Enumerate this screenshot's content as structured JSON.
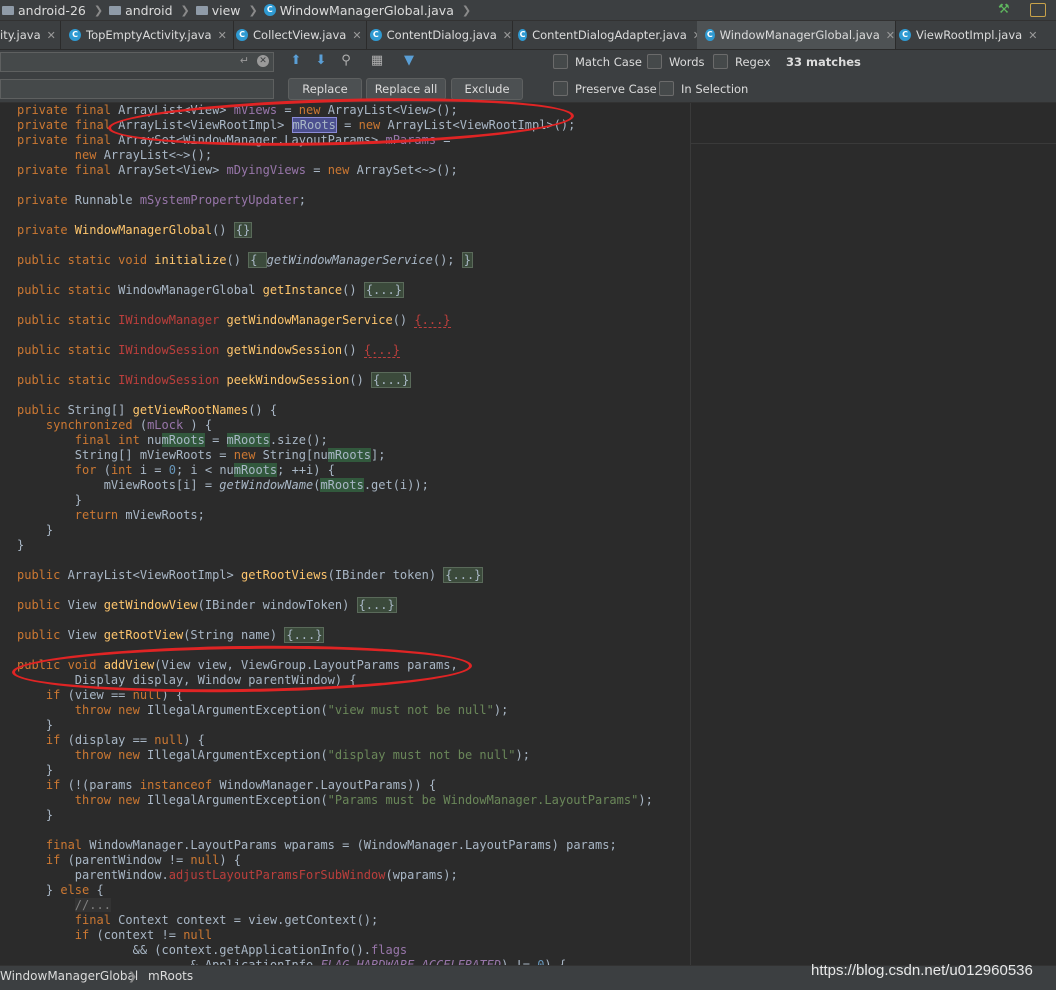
{
  "navbar": {
    "crumbs": [
      "android-26",
      "android",
      "view",
      "WindowManagerGlobal.java"
    ]
  },
  "tabs": [
    {
      "label": "ity.java",
      "active": false
    },
    {
      "label": "TopEmptyActivity.java",
      "active": false
    },
    {
      "label": "CollectView.java",
      "active": false
    },
    {
      "label": "ContentDialog.java",
      "active": false
    },
    {
      "label": "ContentDialogAdapter.java",
      "active": false
    },
    {
      "label": "WindowManagerGlobal.java",
      "active": true
    },
    {
      "label": "ViewRootImpl.java",
      "active": false
    }
  ],
  "find": {
    "search_value": "",
    "replace_value": "",
    "replace_label": "Replace",
    "replace_all_label": "Replace all",
    "exclude_label": "Exclude",
    "match_case_label": "Match Case",
    "words_label": "Words",
    "regex_label": "Regex",
    "matches_label": "33 matches",
    "preserve_case_label": "Preserve Case",
    "in_selection_label": "In Selection"
  },
  "editor": {
    "lines": [
      [
        [
          "kw",
          "private final "
        ],
        [
          "",
          "ArrayList<View> "
        ],
        [
          "fld",
          "mViews"
        ],
        [
          "",
          " = "
        ],
        [
          "kw",
          "new "
        ],
        [
          "",
          "ArrayList<View>();"
        ]
      ],
      [
        [
          "kw",
          "private final "
        ],
        [
          "",
          "ArrayList<ViewRootImpl> "
        ],
        [
          "sel",
          "mRoots"
        ],
        [
          "",
          " = "
        ],
        [
          "kw",
          "new "
        ],
        [
          "",
          "ArrayList<ViewRootImpl>();"
        ]
      ],
      [
        [
          "kw",
          "private final "
        ],
        [
          "",
          "ArraySet<WindowManager.LayoutParams> "
        ],
        [
          "fld",
          "mParams"
        ],
        [
          "",
          " ="
        ]
      ],
      [
        [
          "",
          "        "
        ],
        [
          "kw",
          "new "
        ],
        [
          "",
          "ArrayList<~>();"
        ]
      ],
      [
        [
          "kw",
          "private final "
        ],
        [
          "",
          "ArraySet<View> "
        ],
        [
          "fld",
          "mDyingViews"
        ],
        [
          "",
          " = "
        ],
        [
          "kw",
          "new "
        ],
        [
          "",
          "ArraySet<~>();"
        ]
      ],
      [],
      [
        [
          "kw",
          "private "
        ],
        [
          "",
          "Runnable "
        ],
        [
          "fld",
          "mSystemPropertyUpdater"
        ],
        [
          "",
          ";"
        ]
      ],
      [],
      [
        [
          "kw",
          "private "
        ],
        [
          "fn",
          "WindowManagerGlobal"
        ],
        [
          "",
          "() "
        ],
        [
          "fold",
          "{}"
        ]
      ],
      [],
      [
        [
          "kw",
          "public static void "
        ],
        [
          "fn",
          "initialize"
        ],
        [
          "",
          "() "
        ],
        [
          "fold",
          "{ "
        ],
        [
          "itl",
          "getWindowManagerService"
        ],
        [
          "",
          "(); "
        ],
        [
          "fold",
          "}"
        ]
      ],
      [],
      [
        [
          "kw",
          "public static "
        ],
        [
          "",
          "WindowManagerGlobal "
        ],
        [
          "fn",
          "getInstance"
        ],
        [
          "",
          "() "
        ],
        [
          "fold",
          "{...}"
        ]
      ],
      [],
      [
        [
          "kw",
          "public static "
        ],
        [
          "err",
          "IWindowManager "
        ],
        [
          "fn",
          "getWindowManagerService"
        ],
        [
          "",
          "() "
        ],
        [
          "foldr",
          "{...}"
        ]
      ],
      [],
      [
        [
          "kw",
          "public static "
        ],
        [
          "err",
          "IWindowSession "
        ],
        [
          "fn",
          "getWindowSession"
        ],
        [
          "",
          "() "
        ],
        [
          "foldr",
          "{...}"
        ]
      ],
      [],
      [
        [
          "kw",
          "public static "
        ],
        [
          "err",
          "IWindowSession "
        ],
        [
          "fn",
          "peekWindowSession"
        ],
        [
          "",
          "() "
        ],
        [
          "fold",
          "{...}"
        ]
      ],
      [],
      [
        [
          "kw",
          "public "
        ],
        [
          "",
          "String[] "
        ],
        [
          "fn",
          "getViewRootNames"
        ],
        [
          "",
          "() {"
        ]
      ],
      [
        [
          "",
          "    "
        ],
        [
          "kw",
          "synchronized "
        ],
        [
          "",
          "("
        ],
        [
          "fld",
          "mLock"
        ],
        [
          "",
          " ) {"
        ]
      ],
      [
        [
          "",
          "        "
        ],
        [
          "kw",
          "final int "
        ],
        [
          "",
          "nu"
        ],
        [
          "match",
          "mRoots"
        ],
        [
          "",
          " = "
        ],
        [
          "match",
          "mRoots"
        ],
        [
          "",
          ".size();"
        ]
      ],
      [
        [
          "",
          "        String[] mViewRoots = "
        ],
        [
          "kw",
          "new "
        ],
        [
          "",
          "String[nu"
        ],
        [
          "match",
          "mRoots"
        ],
        [
          "",
          "];"
        ]
      ],
      [
        [
          "",
          "        "
        ],
        [
          "kw",
          "for "
        ],
        [
          "",
          "("
        ],
        [
          "kw",
          "int "
        ],
        [
          "",
          "i = "
        ],
        [
          "num",
          "0"
        ],
        [
          "",
          "; i < nu"
        ],
        [
          "match",
          "mRoots"
        ],
        [
          "",
          "; ++i) {"
        ]
      ],
      [
        [
          "",
          "            mViewRoots[i] = "
        ],
        [
          "itl",
          "getWindowName"
        ],
        [
          "",
          "("
        ],
        [
          "match",
          "mRoots"
        ],
        [
          "",
          ".get(i));"
        ]
      ],
      [
        [
          "",
          "        }"
        ]
      ],
      [
        [
          "",
          "        "
        ],
        [
          "kw",
          "return "
        ],
        [
          "",
          "mViewRoots;"
        ]
      ],
      [
        [
          "",
          "    }"
        ]
      ],
      [
        [
          "",
          "}"
        ]
      ],
      [],
      [
        [
          "kw",
          "public "
        ],
        [
          "",
          "ArrayList<ViewRootImpl> "
        ],
        [
          "fn",
          "getRootViews"
        ],
        [
          "",
          "(IBinder token) "
        ],
        [
          "fold",
          "{...}"
        ]
      ],
      [],
      [
        [
          "kw",
          "public "
        ],
        [
          "",
          "View "
        ],
        [
          "fn",
          "getWindowView"
        ],
        [
          "",
          "(IBinder windowToken) "
        ],
        [
          "fold",
          "{...}"
        ]
      ],
      [],
      [
        [
          "kw",
          "public "
        ],
        [
          "",
          "View "
        ],
        [
          "fn",
          "getRootView"
        ],
        [
          "",
          "(String name) "
        ],
        [
          "fold",
          "{...}"
        ]
      ],
      [],
      [
        [
          "kw",
          "public void "
        ],
        [
          "fn",
          "addView"
        ],
        [
          "",
          "(View view, ViewGroup.LayoutParams params,"
        ]
      ],
      [
        [
          "",
          "        Display display, Window parentWindow) {"
        ]
      ],
      [
        [
          "",
          "    "
        ],
        [
          "kw",
          "if "
        ],
        [
          "",
          "(view == "
        ],
        [
          "kw",
          "null"
        ],
        [
          "",
          ") {"
        ]
      ],
      [
        [
          "",
          "        "
        ],
        [
          "kw",
          "throw new "
        ],
        [
          "",
          "IllegalArgumentException("
        ],
        [
          "st",
          "\"view must not be null\""
        ],
        [
          "",
          ");"
        ]
      ],
      [
        [
          "",
          "    }"
        ]
      ],
      [
        [
          "",
          "    "
        ],
        [
          "kw",
          "if "
        ],
        [
          "",
          "(display == "
        ],
        [
          "kw",
          "null"
        ],
        [
          "",
          ") {"
        ]
      ],
      [
        [
          "",
          "        "
        ],
        [
          "kw",
          "throw new "
        ],
        [
          "",
          "IllegalArgumentException("
        ],
        [
          "st",
          "\"display must not be null\""
        ],
        [
          "",
          ");"
        ]
      ],
      [
        [
          "",
          "    }"
        ]
      ],
      [
        [
          "",
          "    "
        ],
        [
          "kw",
          "if "
        ],
        [
          "",
          "(!(params "
        ],
        [
          "kw",
          "instanceof "
        ],
        [
          "",
          "WindowManager.LayoutParams)) {"
        ]
      ],
      [
        [
          "",
          "        "
        ],
        [
          "kw",
          "throw new "
        ],
        [
          "",
          "IllegalArgumentException("
        ],
        [
          "st",
          "\"Params must be WindowManager.LayoutParams\""
        ],
        [
          "",
          ");"
        ]
      ],
      [
        [
          "",
          "    }"
        ]
      ],
      [],
      [
        [
          "",
          "    "
        ],
        [
          "kw",
          "final "
        ],
        [
          "",
          "WindowManager.LayoutParams wparams = (WindowManager.LayoutParams) params;"
        ]
      ],
      [
        [
          "",
          "    "
        ],
        [
          "kw",
          "if "
        ],
        [
          "",
          "(parentWindow != "
        ],
        [
          "kw",
          "null"
        ],
        [
          "",
          ") {"
        ]
      ],
      [
        [
          "",
          "        parentWindow."
        ],
        [
          "err",
          "adjustLayoutParamsForSubWindow"
        ],
        [
          "",
          "(wparams);"
        ]
      ],
      [
        [
          "",
          "    } "
        ],
        [
          "kw",
          "else "
        ],
        [
          "",
          "{"
        ]
      ],
      [
        [
          "",
          "        "
        ],
        [
          "cmt",
          "//..."
        ]
      ],
      [
        [
          "",
          "        "
        ],
        [
          "kw",
          "final "
        ],
        [
          "",
          "Context context = view.getContext();"
        ]
      ],
      [
        [
          "",
          "        "
        ],
        [
          "kw",
          "if "
        ],
        [
          "",
          "(context != "
        ],
        [
          "kw",
          "null"
        ]
      ],
      [
        [
          "",
          "                && (context.getApplicationInfo()."
        ],
        [
          "fld",
          "flags"
        ]
      ],
      [
        [
          "",
          "                        & ApplicationInfo."
        ],
        [
          "fld itl",
          "FLAG_HARDWARE_ACCELERATED"
        ],
        [
          "",
          ") != "
        ],
        [
          "num",
          "0"
        ],
        [
          "",
          ") {"
        ]
      ]
    ]
  },
  "statusbar": {
    "class_name": "WindowManagerGlobal",
    "member_name": "mRoots"
  },
  "watermark": "https://blog.csdn.net/u012960536"
}
